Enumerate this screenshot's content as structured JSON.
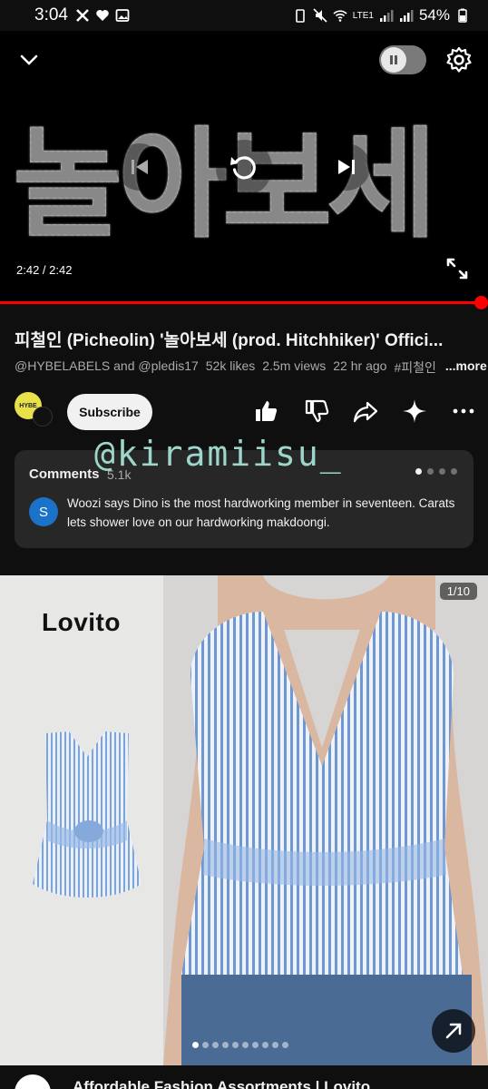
{
  "status_bar": {
    "time": "3:04",
    "network": "LTE1",
    "battery": "54%"
  },
  "player": {
    "poster_text": "놀아보세",
    "time": "2:42 / 2:42",
    "progress": 1.0,
    "autoplay_on": false
  },
  "video": {
    "title": "피철인 (Picheolin) '놀아보세 (prod. Hitchhiker)' Offici...",
    "channels": "@HYBELABELS and @pledis17",
    "likes": "52k likes",
    "views": "2.5m views",
    "age": "22 hr ago",
    "hashtag": "#피철인",
    "more_label": "...more"
  },
  "channel": {
    "avatar_text": "HYBE",
    "subscribe_label": "Subscribe"
  },
  "comments": {
    "heading": "Comments",
    "count": "5.1k",
    "first_author_initial": "S",
    "first_comment": "Woozi says Dino is the most hardworking member in seventeen. Carats lets shower love on our hardworking makdoongi."
  },
  "watermark": "@kiramiisu_",
  "ad": {
    "brand": "Lovito",
    "counter": "1/10",
    "title": "Affordable Fashion Assortments | Lovito"
  },
  "colors": {
    "accent": "#ff0000",
    "background": "#0f0f0f",
    "card": "#272727"
  }
}
